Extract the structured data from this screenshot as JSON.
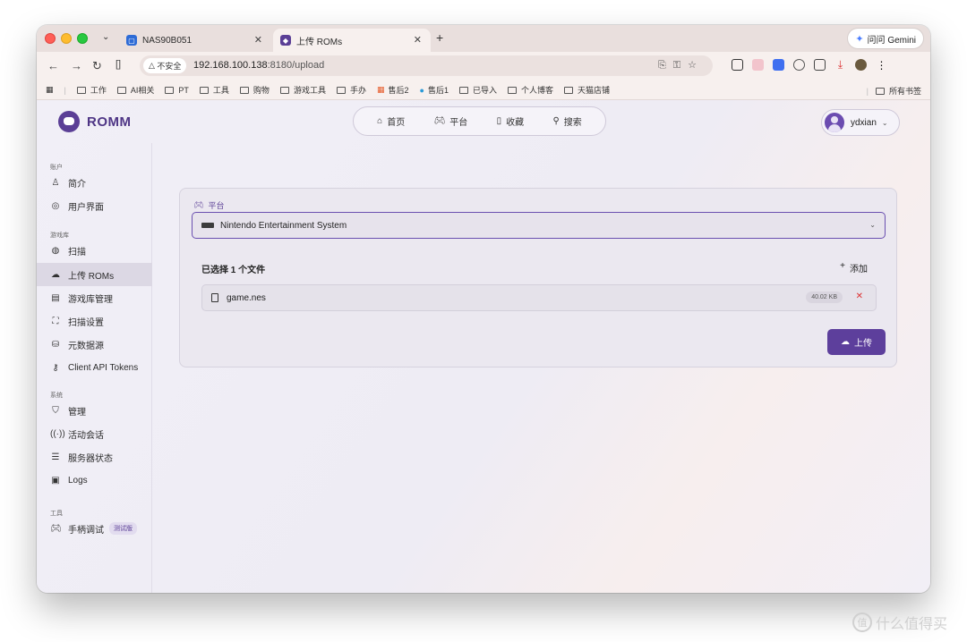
{
  "browser": {
    "tabs": [
      {
        "title": "NAS90B051",
        "favicon_color": "#2d6bd6"
      },
      {
        "title": "上传 ROMs",
        "favicon_color": "#5b3f96"
      }
    ],
    "gemini_label": "问问 Gemini",
    "security_label": "不安全",
    "url_host": "192.168.100.138",
    "url_rest": ":8180/upload",
    "bookmarks": [
      "工作",
      "AI相关",
      "PT",
      "工具",
      "购物",
      "游戏工具",
      "手办",
      "售后2",
      "售后1",
      "已导入",
      "个人博客",
      "天猫店铺"
    ],
    "all_bookmarks": "所有书签"
  },
  "app": {
    "brand": "ROMM",
    "nav": {
      "home": "首页",
      "platforms": "平台",
      "collections": "收藏",
      "search": "搜索"
    },
    "user": "ydxian"
  },
  "sidebar": {
    "sections": {
      "account": "账户",
      "library": "游戏库",
      "system": "系统",
      "tools": "工具"
    },
    "items": {
      "profile": "简介",
      "ui": "用户界面",
      "scan": "扫描",
      "upload": "上传 ROMs",
      "library_mgmt": "游戏库管理",
      "scan_settings": "扫描设置",
      "metadata": "元数据源",
      "api_tokens": "Client API Tokens",
      "admin": "管理",
      "sessions": "活动会话",
      "server_status": "服务器状态",
      "logs": "Logs",
      "controller": "手柄调试",
      "controller_badge": "测试版"
    }
  },
  "upload": {
    "platform_label": "平台",
    "platform_value": "Nintendo Entertainment System",
    "selected_count": "已选择 1 个文件",
    "add_label": "添加",
    "file": {
      "name": "game.nes",
      "size": "40.02 KB"
    },
    "upload_label": "上传"
  },
  "watermark": "什么值得买",
  "colors": {
    "accent": "#5d3f9c",
    "danger": "#dd3333"
  }
}
